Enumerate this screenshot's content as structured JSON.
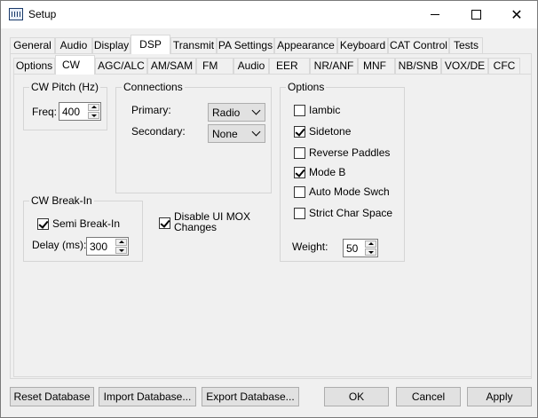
{
  "window": {
    "title": "Setup"
  },
  "main_tabs": [
    "General",
    "Audio",
    "Display",
    "DSP",
    "Transmit",
    "PA Settings",
    "Appearance",
    "Keyboard",
    "CAT Control",
    "Tests"
  ],
  "sub_tabs": [
    "Options",
    "CW",
    "AGC/ALC",
    "AM/SAM",
    "FM",
    "Audio",
    "EER",
    "NR/ANF",
    "MNF",
    "NB/SNB",
    "VOX/DE",
    "CFC"
  ],
  "cw_pitch": {
    "title": "CW Pitch (Hz)",
    "freq_label": "Freq:",
    "freq_value": "400"
  },
  "connections": {
    "title": "Connections",
    "primary_label": "Primary:",
    "primary_value": "Radio",
    "secondary_label": "Secondary:",
    "secondary_value": "None"
  },
  "options": {
    "title": "Options",
    "checkboxes": [
      {
        "label": "Iambic",
        "checked": false
      },
      {
        "label": "Sidetone",
        "checked": true
      },
      {
        "label": "Reverse Paddles",
        "checked": false
      },
      {
        "label": "Mode B",
        "checked": true
      },
      {
        "label": "Auto Mode Swch",
        "checked": false
      },
      {
        "label": "Strict Char Space",
        "checked": false
      }
    ],
    "weight_label": "Weight:",
    "weight_value": "50"
  },
  "break_in": {
    "title": "CW Break-In",
    "semi_label": "Semi Break-In",
    "semi_checked": true,
    "delay_label": "Delay (ms):",
    "delay_value": "300"
  },
  "disable_mox": {
    "label_line1": "Disable UI MOX",
    "label_line2": "Changes",
    "checked": true
  },
  "footer": {
    "reset": "Reset Database",
    "import": "Import Database...",
    "export": "Export Database...",
    "ok": "OK",
    "cancel": "Cancel",
    "apply": "Apply"
  }
}
